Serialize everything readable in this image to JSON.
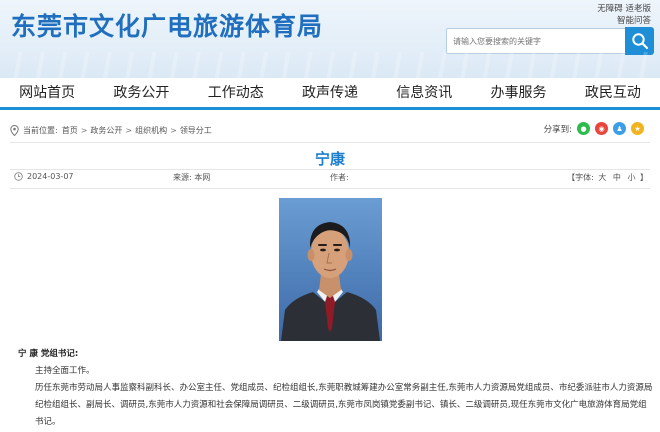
{
  "header": {
    "site_title": "东莞市文化广电旅游体育局",
    "top_links": [
      "无障碍 适老版",
      "智能问答"
    ],
    "search_placeholder": "请输入您要搜索的关键字"
  },
  "nav": {
    "items": [
      "网站首页",
      "政务公开",
      "工作动态",
      "政声传递",
      "信息资讯",
      "办事服务",
      "政民互动"
    ]
  },
  "breadcrumb": {
    "prefix": "当前位置:",
    "items": [
      "首页",
      "政务公开",
      "组织机构",
      "领导分工"
    ],
    "separator": ">"
  },
  "share": {
    "label": "分享到:",
    "icons": [
      {
        "name": "wechat-icon",
        "color": "#2dbb4e",
        "glyph": "✆"
      },
      {
        "name": "weibo-icon",
        "color": "#e8463d",
        "glyph": "◉"
      },
      {
        "name": "qq-icon",
        "color": "#3d9ee8",
        "glyph": "♟"
      },
      {
        "name": "qzone-icon",
        "color": "#f2b320",
        "glyph": "★"
      }
    ]
  },
  "article": {
    "title": "宁康",
    "date": "2024-03-07",
    "source_label": "来源:",
    "source_value": "本网",
    "author_label": "作者:",
    "author_value": "",
    "font_size_label": "【字体:",
    "font_sizes": [
      "大",
      "中",
      "小"
    ],
    "font_size_close": "】",
    "heading": "宁 康  党组书记:",
    "paragraph1": "主持全面工作。",
    "paragraph2": "历任东莞市劳动局人事监察科副科长、办公室主任、党组成员、纪检组组长,东莞职教城筹建办公室常务副主任,东莞市人力资源局党组成员、市纪委派驻市人力资源局纪检组组长、副局长、调研员,东莞市人力资源和社会保障局调研员、二级调研员,东莞市凤岗镇党委副书记、镇长、二级调研员,现任东莞市文化广电旅游体育局党组书记。"
  }
}
